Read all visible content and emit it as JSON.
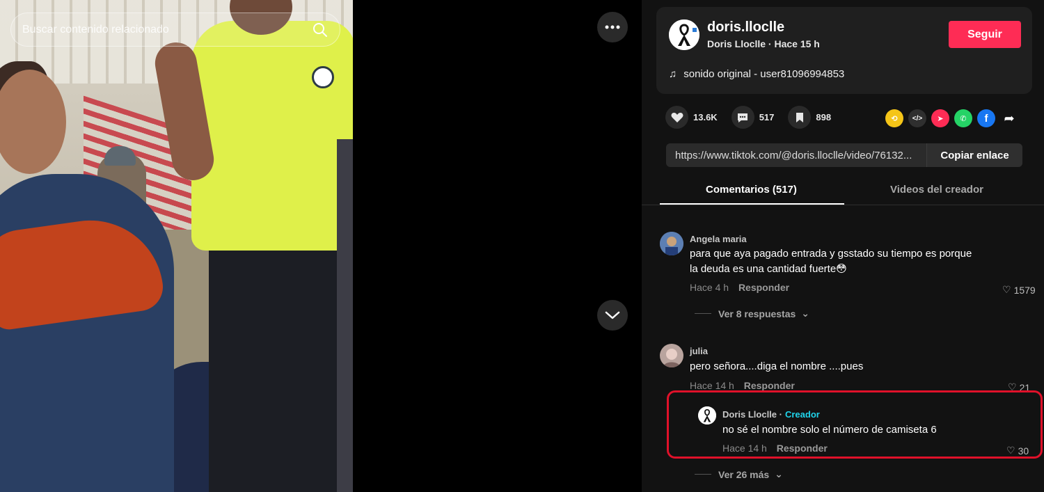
{
  "search": {
    "placeholder": "Buscar contenido relacionado"
  },
  "author": {
    "username": "doris.lloclle",
    "display_line": "Doris Lloclle · Hace 15 h",
    "follow_label": "Seguir",
    "music": "sonido original - user81096994853"
  },
  "stats": {
    "likes": "13.6K",
    "comments": "517",
    "saves": "898"
  },
  "share": {
    "link": "https://www.tiktok.com/@doris.lloclle/video/76132...",
    "copy_label": "Copiar enlace",
    "icons": [
      "repost-icon",
      "embed-icon",
      "send-icon",
      "whatsapp-icon",
      "facebook-icon",
      "share-arrow-icon"
    ]
  },
  "tabs": {
    "comments": "Comentarios (517)",
    "videos": "Videos del creador"
  },
  "comments": [
    {
      "user": "Angela maria",
      "text": "para que aya pagado entrada y gsstado su tiempo es porque la deuda es una cantidad fuerte😳",
      "time": "Hace 4 h",
      "reply_label": "Responder",
      "likes": "1579",
      "more_replies": "Ver 8 respuestas"
    },
    {
      "user": "julia",
      "text": "pero señora....diga el nombre ....pues",
      "time": "Hace 14 h",
      "reply_label": "Responder",
      "likes": "21",
      "reply": {
        "user": "Doris Lloclle ·",
        "creator_tag": "Creador",
        "text": "no sé el nombre solo el número de camiseta 6",
        "time": "Hace 14 h",
        "reply_label": "Responder",
        "likes": "30"
      },
      "more_replies": "Ver 26 más"
    }
  ],
  "colors": {
    "follow": "#fe2c55",
    "creator": "#20d5ec",
    "highlight": "#e0112a",
    "sidebar_bg": "#121212"
  }
}
